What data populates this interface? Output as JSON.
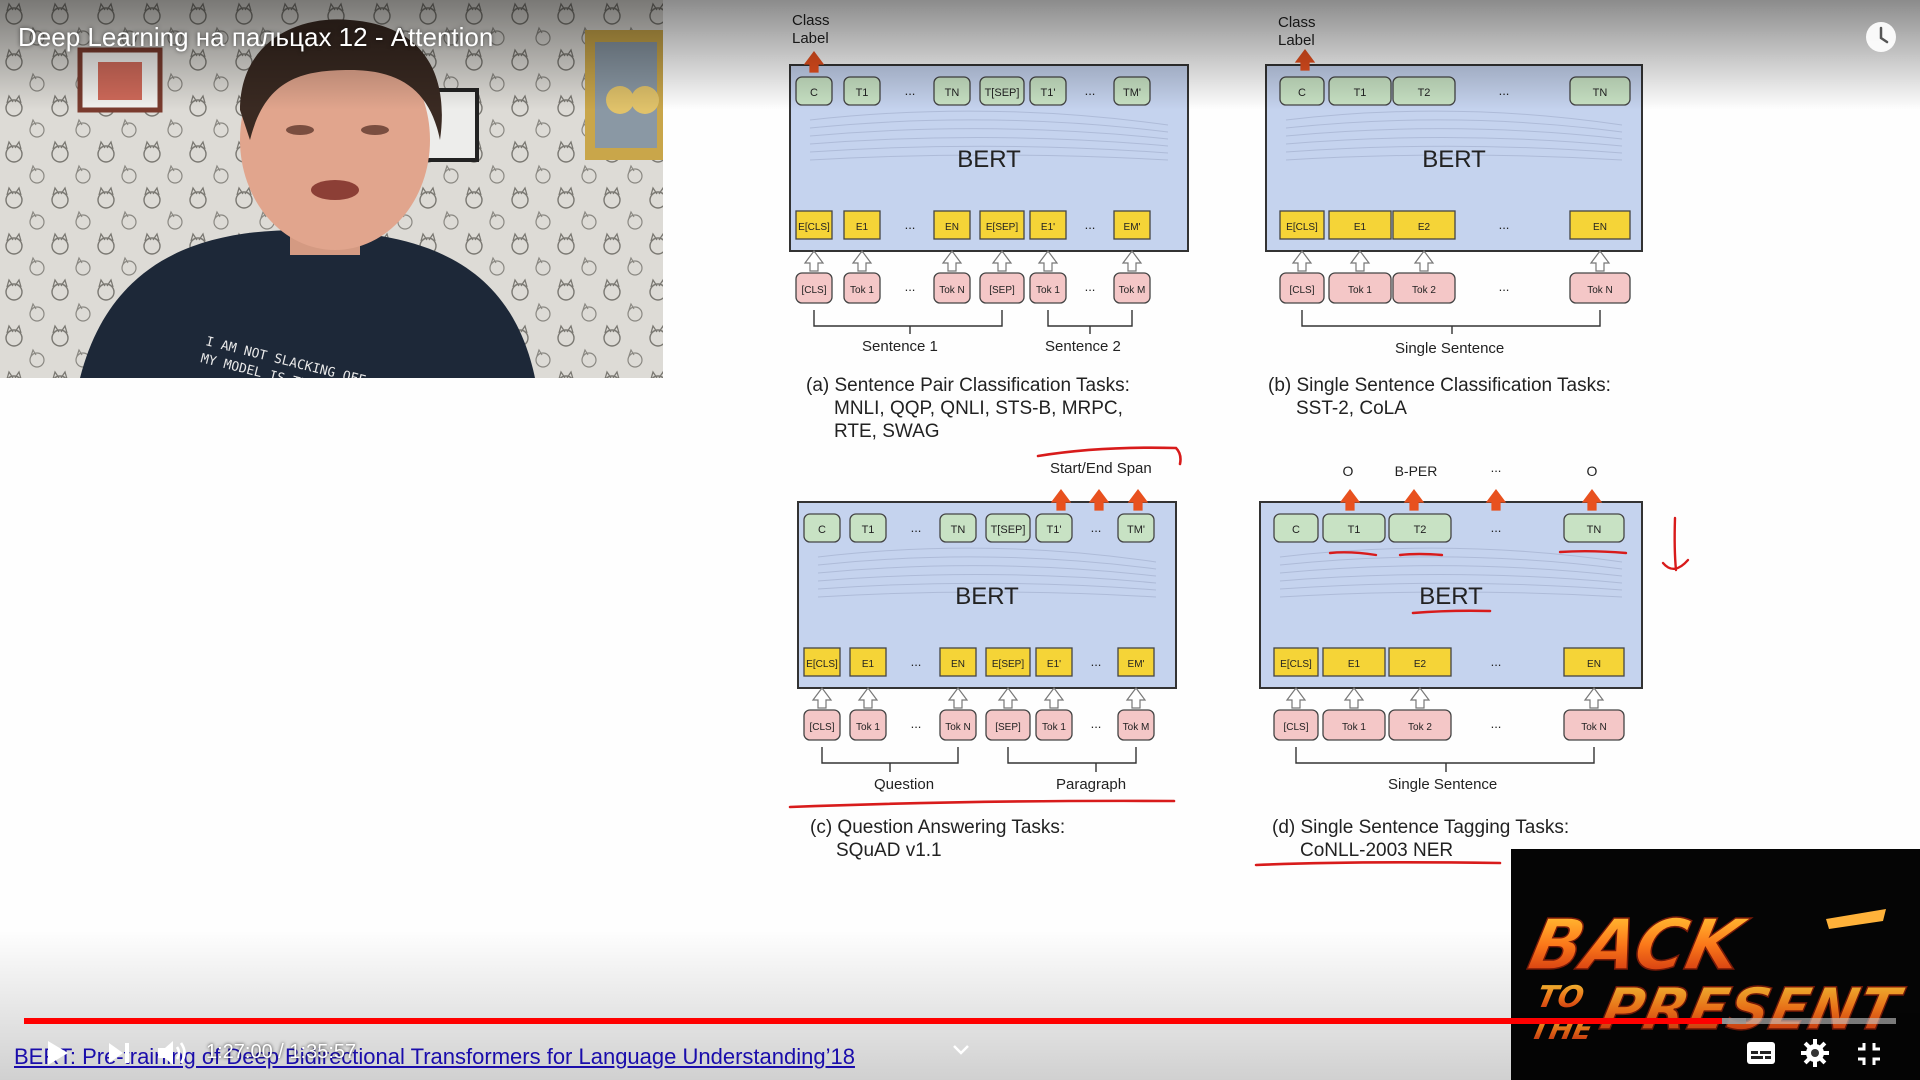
{
  "video": {
    "title": "Deep Learning на пальцах 12 - Attention",
    "current_time": "1:27:00",
    "separator": " / ",
    "duration": "1:35:57",
    "progress": 0.907,
    "buffered": 0.92
  },
  "webcam": {
    "tshirt_text_line1": "I AM NOT SLACKING OFF",
    "tshirt_text_line2": "MY MODEL IS TRAINING"
  },
  "slide": {
    "model_label": "BERT",
    "panel_a": {
      "output_label_line1": "Class",
      "output_label_line2": "Label",
      "outputs": [
        "C",
        "T1",
        "...",
        "TN",
        "T[SEP]",
        "T1'",
        "...",
        "TM'"
      ],
      "embeddings": [
        "E[CLS]",
        "E1",
        "...",
        "EN",
        "E[SEP]",
        "E1'",
        "...",
        "EM'"
      ],
      "tokens": [
        "[CLS]",
        "Tok 1",
        "...",
        "Tok N",
        "[SEP]",
        "Tok 1",
        "...",
        "Tok M"
      ],
      "group_left": "Sentence 1",
      "group_right": "Sentence 2",
      "caption_line1": "(a) Sentence Pair Classification Tasks:",
      "caption_line2": "MNLI, QQP, QNLI, STS-B, MRPC,",
      "caption_line3": "RTE, SWAG"
    },
    "panel_b": {
      "output_label_line1": "Class",
      "output_label_line2": "Label",
      "outputs": [
        "C",
        "T1",
        "T2",
        "...",
        "TN"
      ],
      "embeddings": [
        "E[CLS]",
        "E1",
        "E2",
        "...",
        "EN"
      ],
      "tokens": [
        "[CLS]",
        "Tok 1",
        "Tok 2",
        "...",
        "Tok N"
      ],
      "group": "Single Sentence",
      "caption_line1": "(b) Single Sentence Classification Tasks:",
      "caption_line2": "SST-2, CoLA"
    },
    "panel_c": {
      "output_label": "Start/End Span",
      "outputs": [
        "C",
        "T1",
        "...",
        "TN",
        "T[SEP]",
        "T1'",
        "...",
        "TM'"
      ],
      "embeddings": [
        "E[CLS]",
        "E1",
        "...",
        "EN",
        "E[SEP]",
        "E1'",
        "...",
        "EM'"
      ],
      "tokens": [
        "[CLS]",
        "Tok 1",
        "...",
        "Tok N",
        "[SEP]",
        "Tok 1",
        "...",
        "Tok M"
      ],
      "group_left": "Question",
      "group_right": "Paragraph",
      "caption_line1": "(c) Question Answering Tasks:",
      "caption_line2": "SQuAD v1.1"
    },
    "panel_d": {
      "output_tags": [
        "O",
        "B-PER",
        "...",
        "O"
      ],
      "outputs": [
        "C",
        "T1",
        "T2",
        "...",
        "TN"
      ],
      "embeddings": [
        "E[CLS]",
        "E1",
        "E2",
        "...",
        "EN"
      ],
      "tokens": [
        "[CLS]",
        "Tok 1",
        "Tok 2",
        "...",
        "Tok N"
      ],
      "group": "Single Sentence",
      "caption_line1": "(d) Single Sentence Tagging Tasks:",
      "caption_line2": "CoNLL-2003 NER"
    }
  },
  "card": {
    "line1": "BACK",
    "line2": "TO",
    "line3": "THE",
    "line4": "PRESENT"
  },
  "chapter_link": "BERT: Pre-training of Deep Bidirectional Transformers for Language Understanding’18",
  "icons": {
    "play": "play-icon",
    "next": "next-icon",
    "volume": "volume-icon",
    "chapters": "chevron-down-icon",
    "subtitles": "subtitles-icon",
    "settings": "gear-icon",
    "fullscreen_exit": "exit-fullscreen-icon",
    "watch_later": "clock-icon"
  },
  "colors": {
    "bert_box": "#c5d3ee",
    "output_cell": "#c8e2c4",
    "embedding_cell": "#f5d437",
    "token_cell": "#f4c7c7",
    "arrow_up_red": "#e8511f",
    "annotation_red": "#d81b1b",
    "progress_played": "#ff0000"
  }
}
